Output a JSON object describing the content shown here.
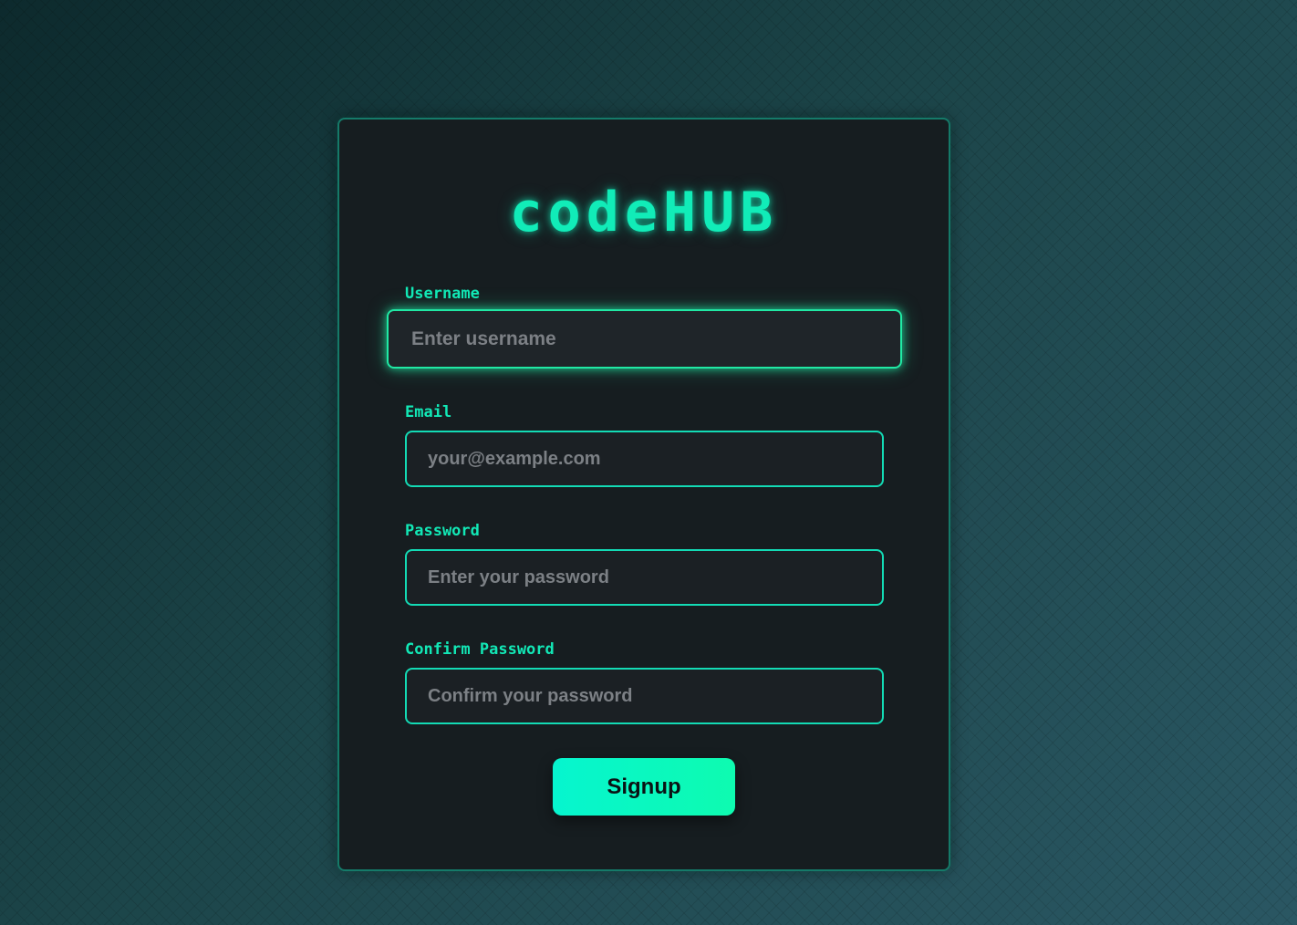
{
  "brand": {
    "logo_text": "codeHUB"
  },
  "form": {
    "username": {
      "label": "Username",
      "placeholder": "Enter username",
      "value": ""
    },
    "email": {
      "label": "Email",
      "placeholder": "your@example.com",
      "value": ""
    },
    "password": {
      "label": "Password",
      "placeholder": "Enter your password",
      "value": ""
    },
    "confirm_password": {
      "label": "Confirm Password",
      "placeholder": "Confirm your password",
      "value": ""
    },
    "submit_label": "Signup",
    "focused_field": "username"
  },
  "colors": {
    "accent": "#11ecb8",
    "card_background": "#161d20",
    "button_gradient_start": "#06f5cf",
    "button_gradient_end": "#0efbb0"
  }
}
